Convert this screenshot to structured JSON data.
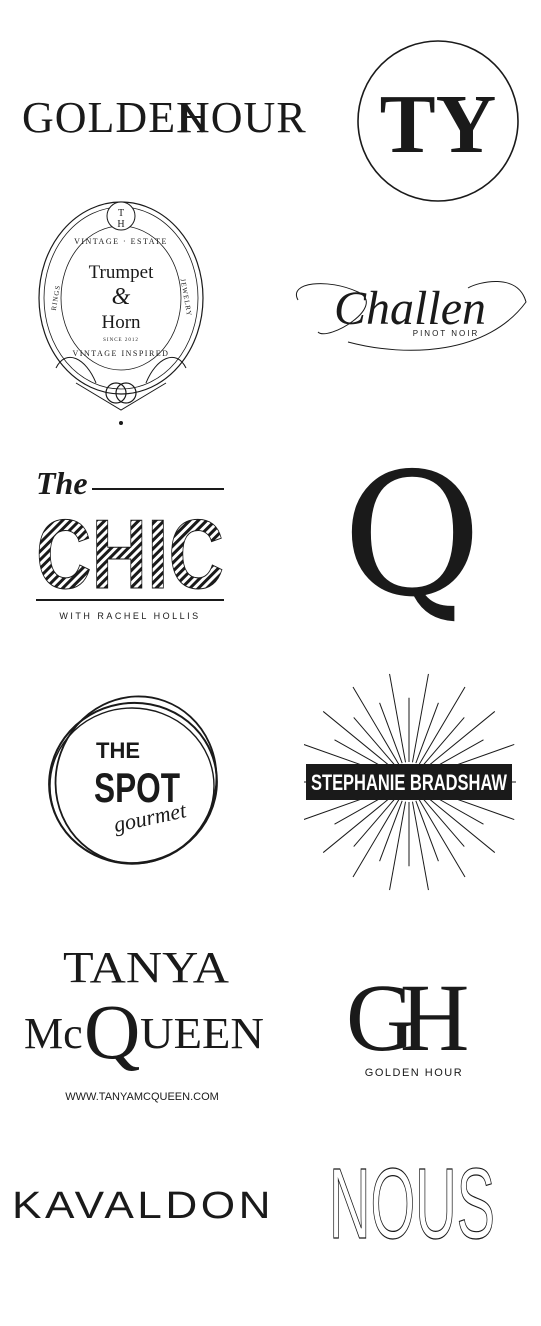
{
  "logos": {
    "golden_hour_wordmark": {
      "text_a": "GOLDEN",
      "text_b": "HOUR"
    },
    "ty_monogram": {
      "text": "TY"
    },
    "trumpet_horn": {
      "top_arc": "VINTAGE · ESTATE",
      "left": "RINGS",
      "right": "JEWELRY",
      "name_1": "Trumpet",
      "ampersand": "&",
      "name_2": "Horn",
      "since": "SINCE 2012",
      "bottom_arc": "VINTAGE INSPIRED",
      "mono_top": "T",
      "mono_bottom": "H"
    },
    "challen": {
      "name": "Challen",
      "sub": "PINOT NOIR"
    },
    "the_chic": {
      "the": "The",
      "chic": "CHIC",
      "tagline": "WITH RACHEL HOLLIS"
    },
    "q_mark": {
      "letter": "Q"
    },
    "the_spot": {
      "the": "THE",
      "spot": "SPOT",
      "gourmet": "gourmet"
    },
    "stephanie_bradshaw": {
      "name": "STEPHANIE BRADSHAW"
    },
    "tanya_mcqueen": {
      "line1": "TANYA",
      "mc": "Mc",
      "q": "Q",
      "ueen": "UEEN",
      "url": "WWW.TANYAMCQUEEN.COM"
    },
    "gh_monogram": {
      "g": "G",
      "h": "H",
      "label": "GOLDEN HOUR"
    },
    "kavaldon": {
      "text": "KAVALDON"
    },
    "nous": {
      "text": "NOUS"
    }
  }
}
